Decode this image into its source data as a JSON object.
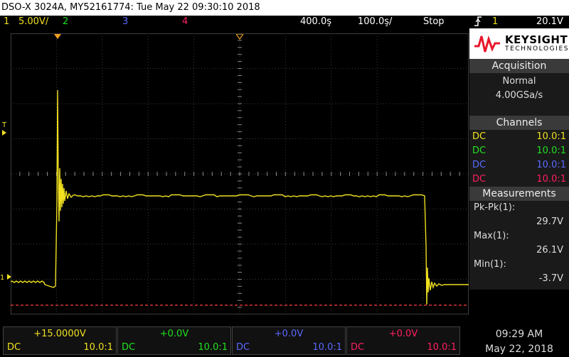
{
  "title": "DSO-X 3024A, MY52161774: Tue May 22 09:30:10 2018",
  "topbar": {
    "ch1_num": "1",
    "ch1_scale": "5.00V/",
    "ch2_num": "2",
    "ch3_num": "3",
    "ch4_num": "4",
    "timebase": "400.0ş",
    "delay": "100.0ş/",
    "run_state": "Stop"
  },
  "trigger": {
    "icon": "trigger-edge-icon",
    "source": "1",
    "level": "20.1V"
  },
  "logo": {
    "brand": "KEYSIGHT",
    "sub": "TECHNOLOGIES"
  },
  "acquisition": {
    "header": "Acquisition",
    "mode": "Normal",
    "rate": "4.00GSa/s"
  },
  "channels": {
    "header": "Channels",
    "rows": [
      {
        "coupling": "DC",
        "probe": "10.0:1",
        "color": "#f0e020"
      },
      {
        "coupling": "DC",
        "probe": "10.0:1",
        "color": "#20e020"
      },
      {
        "coupling": "DC",
        "probe": "10.0:1",
        "color": "#5a6aff"
      },
      {
        "coupling": "DC",
        "probe": "10.0:1",
        "color": "#ff2060"
      }
    ]
  },
  "measurements": {
    "header": "Measurements",
    "items": [
      {
        "label": "Pk-Pk(1):",
        "value": "29.7V"
      },
      {
        "label": "Max(1):",
        "value": "26.1V"
      },
      {
        "label": "Min(1):",
        "value": "-3.7V"
      }
    ]
  },
  "bottom_channels": [
    {
      "offset": "+15.0000V",
      "coupling": "DC",
      "probe": "10.0:1",
      "color": "#f0e020"
    },
    {
      "offset": "+0.0V",
      "coupling": "DC",
      "probe": "10.0:1",
      "color": "#20e020"
    },
    {
      "offset": "+0.0V",
      "coupling": "DC",
      "probe": "10.0:1",
      "color": "#5a6aff"
    },
    {
      "offset": "+0.0V",
      "coupling": "DC",
      "probe": "10.0:1",
      "color": "#ff2060"
    }
  ],
  "clock": {
    "time": "09:29 AM",
    "date": "May 22, 2018"
  },
  "markers": {
    "ground": "1",
    "trigger_level": "T"
  },
  "colors": {
    "ch1": "#f0e020",
    "ch2": "#20e020",
    "ch3": "#5a6aff",
    "ch4": "#ff2060",
    "marker": "#f0a020"
  }
}
